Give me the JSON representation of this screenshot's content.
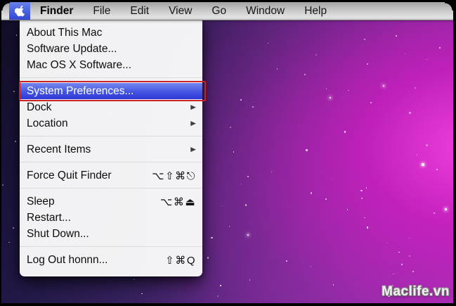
{
  "menu_bar": {
    "items": [
      {
        "label": "Finder",
        "bold": true
      },
      {
        "label": "File"
      },
      {
        "label": "Edit"
      },
      {
        "label": "View"
      },
      {
        "label": "Go"
      },
      {
        "label": "Window"
      },
      {
        "label": "Help"
      }
    ]
  },
  "apple_menu": {
    "items": [
      {
        "type": "item",
        "label": "About This Mac"
      },
      {
        "type": "item",
        "label": "Software Update..."
      },
      {
        "type": "item",
        "label": "Mac OS X Software..."
      },
      {
        "type": "separator"
      },
      {
        "type": "item",
        "label": "System Preferences...",
        "highlighted": true,
        "annotated": true
      },
      {
        "type": "item",
        "label": "Dock",
        "submenu": true
      },
      {
        "type": "item",
        "label": "Location",
        "submenu": true
      },
      {
        "type": "separator"
      },
      {
        "type": "item",
        "label": "Recent Items",
        "submenu": true
      },
      {
        "type": "separator"
      },
      {
        "type": "item",
        "label": "Force Quit Finder",
        "shortcut": "⌥⇧⌘⎋"
      },
      {
        "type": "separator"
      },
      {
        "type": "item",
        "label": "Sleep",
        "shortcut": "⌥⌘⏏"
      },
      {
        "type": "item",
        "label": "Restart..."
      },
      {
        "type": "item",
        "label": "Shut Down..."
      },
      {
        "type": "separator"
      },
      {
        "type": "item",
        "label": "Log Out honnn...",
        "shortcut": "⇧⌘Q"
      }
    ]
  },
  "glyphs": {
    "submenu_arrow": "▶"
  },
  "watermark": {
    "text": "Maclife.vn"
  },
  "colors": {
    "menu_highlight_top": "#7587ef",
    "menu_highlight_bottom": "#2e36d8",
    "apple_highlight_blue": "#4a63e0",
    "annotation_red": "#c92222",
    "menubar_text": "#161616"
  }
}
